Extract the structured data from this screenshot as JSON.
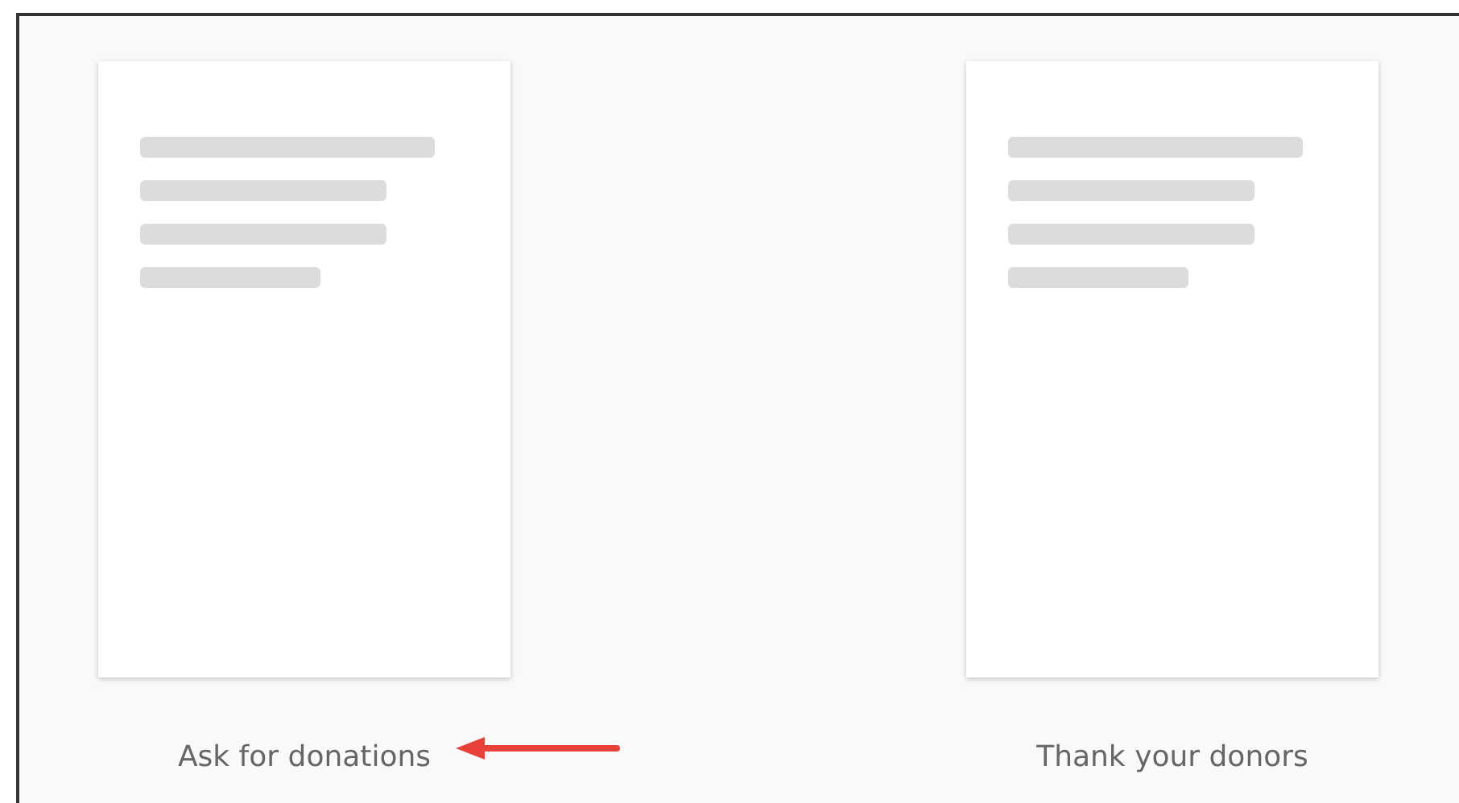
{
  "templates": [
    {
      "label": "Ask for donations"
    },
    {
      "label": "Thank your donors"
    }
  ]
}
